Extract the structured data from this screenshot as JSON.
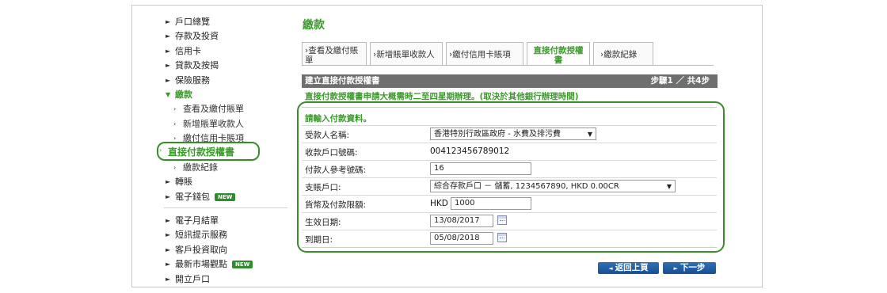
{
  "sidebar": {
    "items": [
      {
        "label": "戶口總覽"
      },
      {
        "label": "存款及投資"
      },
      {
        "label": "信用卡"
      },
      {
        "label": "貸款及按揭"
      },
      {
        "label": "保險服務"
      },
      {
        "label": "繳款"
      },
      {
        "label": "查看及繳付賬單"
      },
      {
        "label": "新增賬單收款人"
      },
      {
        "label": "繳付信用卡賬項"
      },
      {
        "label": "直接付款授權書"
      },
      {
        "label": "繳款紀錄"
      },
      {
        "label": "轉賬"
      },
      {
        "label": "電子錢包"
      }
    ],
    "items2": [
      {
        "label": "電子月結單"
      },
      {
        "label": "短訊提示服務"
      },
      {
        "label": "客戶投資取向"
      },
      {
        "label": "最新市場觀點"
      },
      {
        "label": "開立戶口"
      }
    ],
    "new_badge": "NEW"
  },
  "page_title": "繳款",
  "tabs": [
    {
      "label": "查看及繳付賬單"
    },
    {
      "label": "新增賬單收款人"
    },
    {
      "label": "繳付信用卡賬項"
    },
    {
      "label": "直接付款授權書"
    },
    {
      "label": "繳款紀錄"
    }
  ],
  "section": {
    "title": "建立直接付款授權書",
    "step": "步驟1 ／ 共4步",
    "notice": "直接付款授權書申請大概需時二至四星期辦理。(取決於其他銀行辦理時間)",
    "caption": "請輸入付款資料。"
  },
  "form": {
    "payee_label": "受款人名稱:",
    "payee_value": "香港特別行政區政府 - 水費及排污費",
    "account_label": "收款戶口號碼:",
    "account_value": "004123456789012",
    "ref_label": "付款人參考號碼:",
    "ref_value": "16",
    "debit_label": "支賬戶口:",
    "debit_value": "綜合存款戶口 － 儲蓄, 1234567890, HKD 0.00CR",
    "limit_label": "貨幣及付款限額:",
    "limit_currency": "HKD",
    "limit_value": "1000",
    "effective_label": "生效日期:",
    "effective_value": "13/08/2017",
    "expiry_label": "到期日:",
    "expiry_value": "05/08/2018"
  },
  "buttons": {
    "back": "返回上頁",
    "next": "下一步"
  }
}
